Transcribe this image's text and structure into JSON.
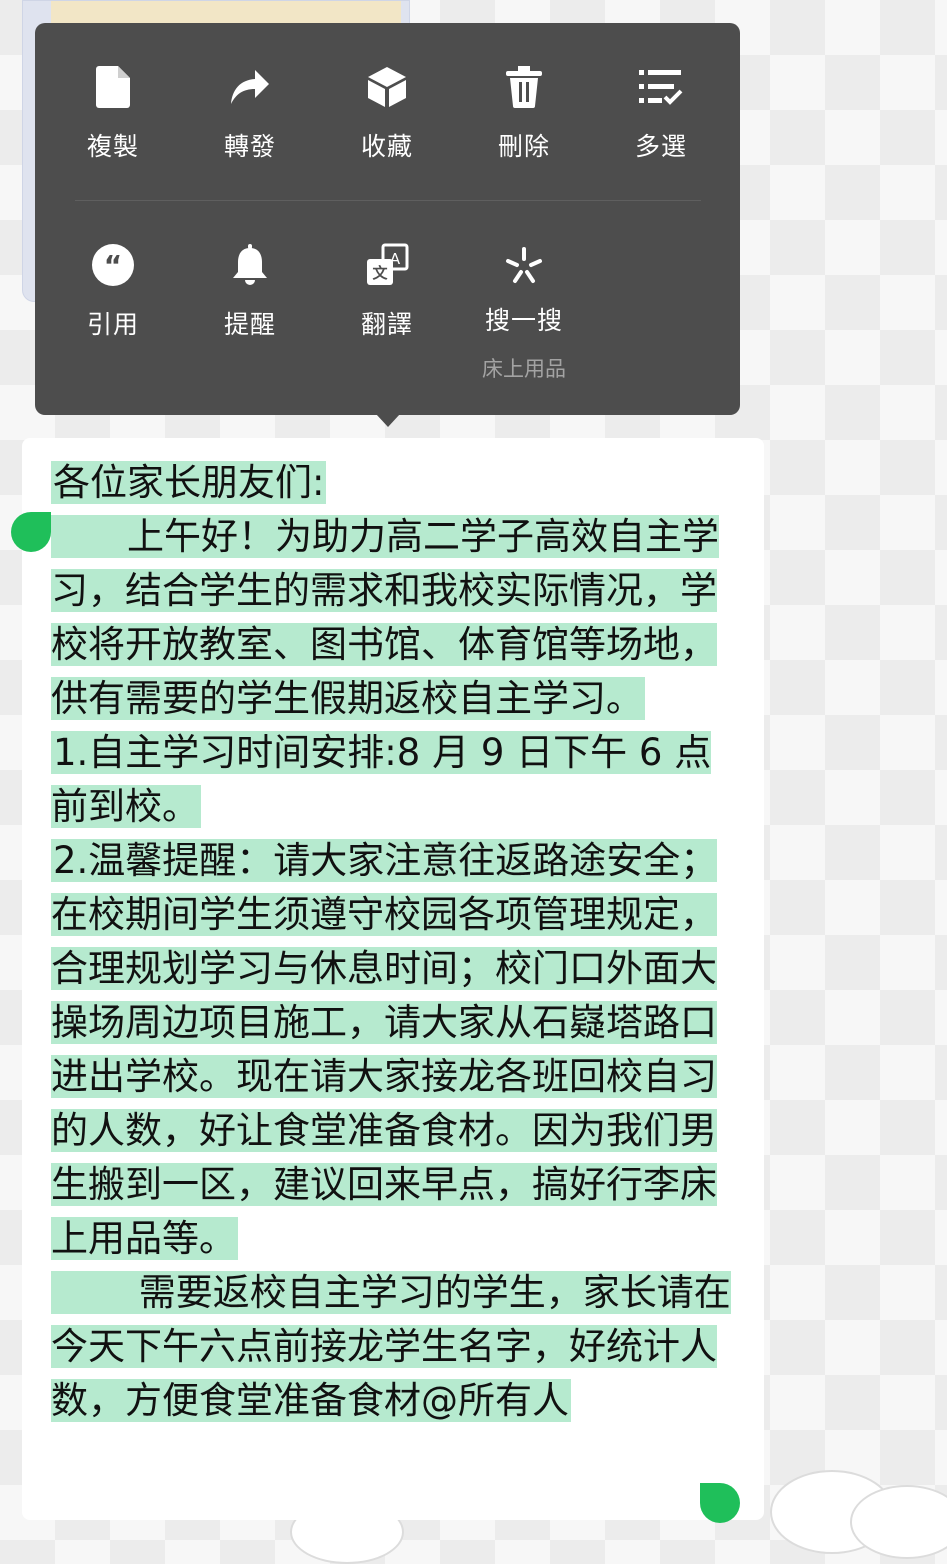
{
  "menu": {
    "row1": [
      {
        "label": "複製",
        "icon": "copy-icon"
      },
      {
        "label": "轉發",
        "icon": "forward-icon"
      },
      {
        "label": "收藏",
        "icon": "favorite-icon"
      },
      {
        "label": "刪除",
        "icon": "delete-icon"
      },
      {
        "label": "多選",
        "icon": "multiselect-icon"
      }
    ],
    "row2": [
      {
        "label": "引用",
        "icon": "quote-icon"
      },
      {
        "label": "提醒",
        "icon": "bell-icon"
      },
      {
        "label": "翻譯",
        "icon": "translate-icon"
      },
      {
        "label": "搜一搜",
        "icon": "search-sparkle-icon",
        "sublabel": "床上用品"
      }
    ]
  },
  "message": {
    "greeting": "各位家长朋友们:",
    "para1": "　　上午好！为助力高二学子高效自主学习，结合学生的需求和我校实际情况，学校将开放教室、图书馆、体育馆等场地，供有需要的学生假期返校自主学习。",
    "item1": "1.自主学习时间安排:8 月 9 日下午 6 点前到校。",
    "item2": "2.温馨提醒：请大家注意往返路途安全；在校期间学生须遵守校园各项管理规定，合理规划学习与休息时间；校门口外面大操场周边项目施工，请大家从石嶷塔路口进出学校。现在请大家接龙各班回校自习的人数，好让食堂准备食材。因为我们男生搬到一区，建议回来早点，搞好行李床上用品等。",
    "para2": "　　 需要返校自主学习的学生，家长请在今天下午六点前接龙学生名字，好统计人数，方便食堂准备食材@所有人"
  },
  "colors": {
    "menu_bg": "#4d4d4d",
    "selection": "#b6eacf",
    "handle": "#1fbf5a"
  }
}
